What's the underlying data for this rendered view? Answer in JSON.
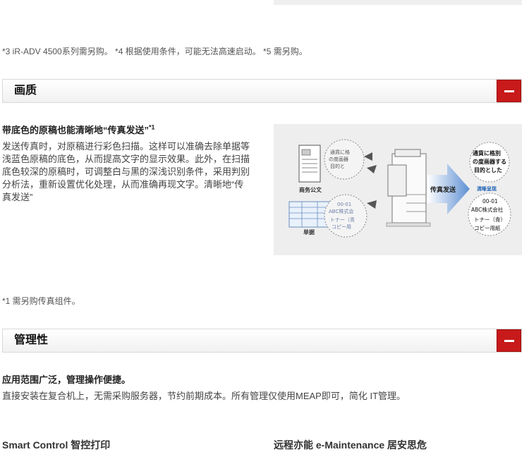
{
  "footnote_top": "*3 iR-ADV 4500系列需另购。 *4 根据使用条件，可能无法高速启动。 *5 需另购。",
  "section_quality": {
    "title": "画质",
    "heading": "带底色的原稿也能清晰地“传真发送”",
    "heading_sup": "*1",
    "body": "发送传真时，对原稿进行彩色扫描。这样可以准确去除单据等浅蓝色原稿的底色，从而提高文字的显示效果。此外，在扫描底色较深的原稿时，可调整白与黑的深浅识别条件，采用判别分析法，重新设置优化处理，从而准确再现文字。清晰地“传真发送”",
    "figure": {
      "label_business_doc": "商务公文",
      "label_voucher": "单据",
      "label_fax_send": "传真发送",
      "label_clear": "清晰呈现",
      "magnifier_top_lines": [
        "通貨に格別",
        "の度画器する",
        "目的とした"
      ],
      "magnifier_bottom_lines": [
        "00-01",
        "ABC株式会社",
        "トナー（青）",
        "コピー用紙"
      ]
    },
    "footnote": "*1 需另购传真组件。"
  },
  "section_manage": {
    "title": "管理性",
    "heading": "应用范围广泛，管理操作便捷。",
    "body": "直接安装在复合机上，无需采购服务器，节约前期成本。所有管理仅使用MEAP即可，简化 IT管理。",
    "sub_left": "Smart Control 智控打印",
    "sub_right": "远程亦能 e-Maintenance 居安思危"
  },
  "colors": {
    "accent_red": "#c81a1a",
    "figure_blue": "#1a5fb4"
  },
  "icons": {
    "collapse": "minus-icon"
  }
}
